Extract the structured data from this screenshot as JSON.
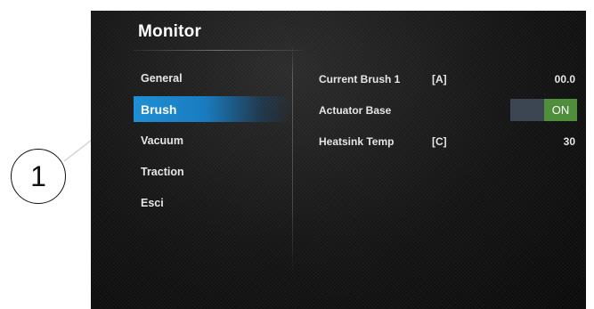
{
  "callout": {
    "number": "1"
  },
  "screen": {
    "title": "Monitor",
    "menu": [
      {
        "label": "General",
        "active": false
      },
      {
        "label": "Brush",
        "active": true
      },
      {
        "label": "Vacuum",
        "active": false
      },
      {
        "label": "Traction",
        "active": false
      },
      {
        "label": "Esci",
        "active": false
      }
    ],
    "rows": [
      {
        "label": "Current Brush 1",
        "unit": "[A]",
        "value": "00.0"
      },
      {
        "label": "Actuator Base",
        "toggle_label": "ON"
      },
      {
        "label": "Heatsink Temp",
        "unit": "[C]",
        "value": "30"
      }
    ]
  },
  "colors": {
    "active_tab": "#1e8fd6",
    "toggle_on": "#4f8f3c",
    "toggle_off": "#3b4652"
  }
}
